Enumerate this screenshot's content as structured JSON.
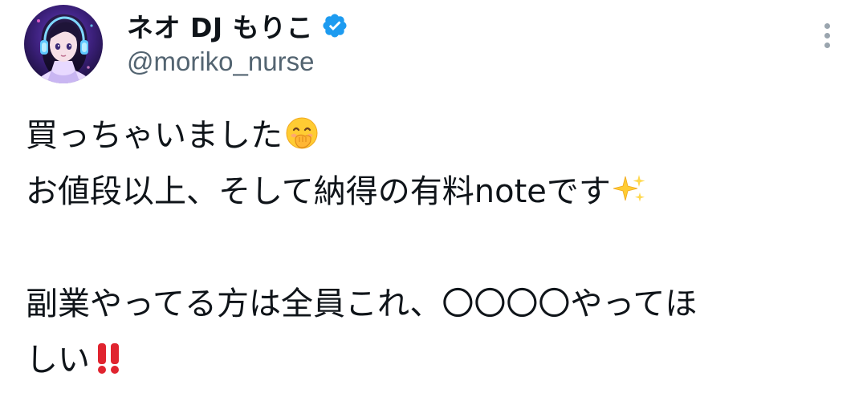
{
  "tweet": {
    "author": {
      "display_name": "ネオ DJ もりこ",
      "handle": "@moriko_nurse",
      "verified": true,
      "avatar": "avatar-illustration"
    },
    "more_icon": "more-vertical-icon",
    "body_lines": [
      "買っちゃいました",
      "お値段以上、そして納得の有料noteです",
      "",
      "副業やってる方は全員これ、〇〇〇〇やってほ",
      "しい"
    ],
    "emojis": {
      "line1": "face-with-hand-over-mouth-emoji",
      "line2": "sparkles-emoji",
      "line5": "double-exclamation-emoji"
    },
    "colors": {
      "text": "#0f1419",
      "secondary": "#536471",
      "verified_blue": "#1d9bf0",
      "more_dots": "#9aa5ae"
    }
  }
}
